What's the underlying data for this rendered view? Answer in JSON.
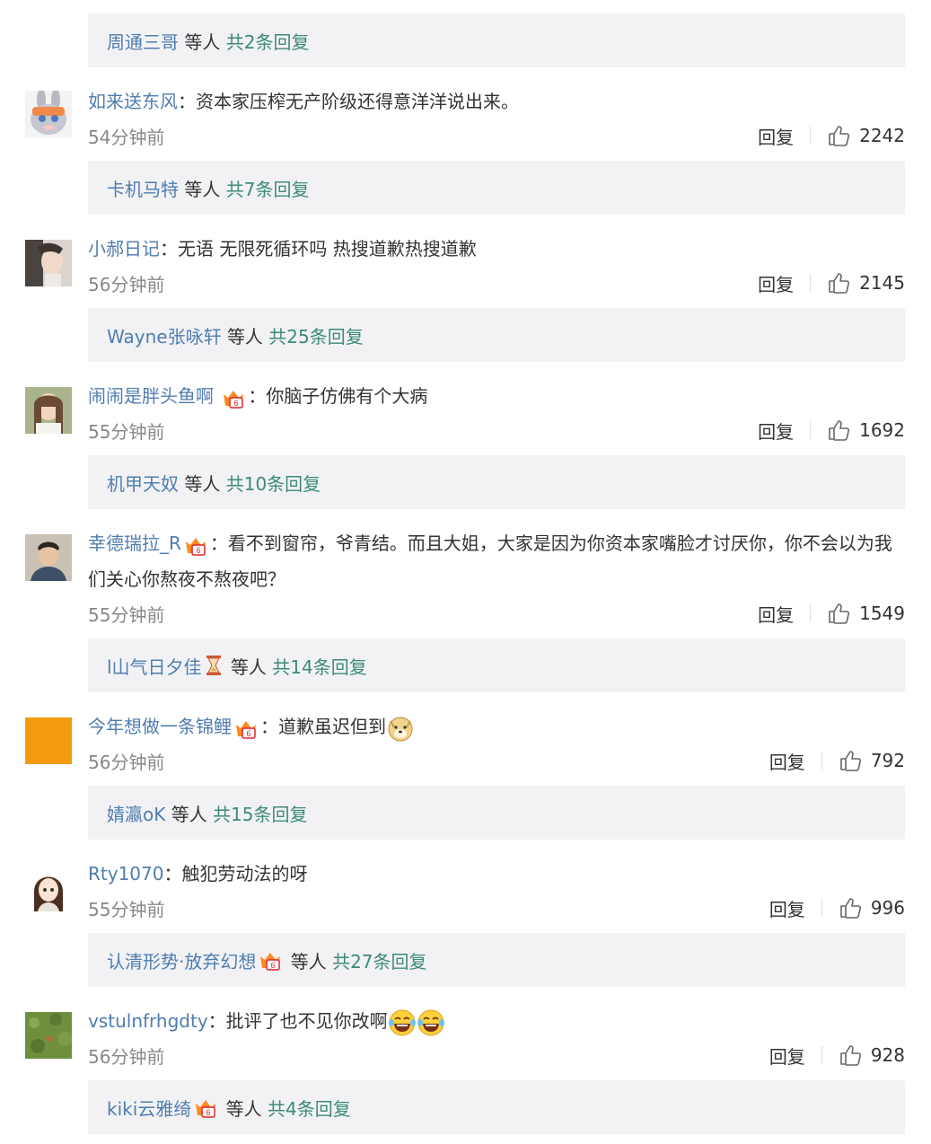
{
  "top_reply": {
    "user": "周通三哥",
    "suffix": "等人",
    "count": "共2条回复"
  },
  "reply_label": "回复",
  "comments": [
    {
      "user": "如来送东风",
      "text": "资本家压榨无产阶级还得意洋洋说出来。",
      "time": "54分钟前",
      "likes": "2242",
      "reply": {
        "user": "卡机马特",
        "suffix": "等人",
        "count": "共7条回复"
      }
    },
    {
      "user": "小郝日记",
      "text": "无语  无限死循环吗 热搜道歉热搜道歉",
      "time": "56分钟前",
      "likes": "2145",
      "reply": {
        "user": "Wayne张咏轩",
        "suffix": "等人",
        "count": "共25条回复"
      }
    },
    {
      "user": "闹闹是胖头鱼啊",
      "text": "你脑子仿佛有个大病",
      "time": "55分钟前",
      "likes": "1692",
      "reply": {
        "user": "机甲天奴",
        "suffix": "等人",
        "count": "共10条回复"
      }
    },
    {
      "user": "幸德瑞拉_R",
      "text": "看不到窗帘，爷青结。而且大姐，大家是因为你资本家嘴脸才讨厌你，你不会以为我们关心你熬夜不熬夜吧？",
      "time": "55分钟前",
      "likes": "1549",
      "reply": {
        "user": "l山气日夕佳",
        "suffix": "等人",
        "count": "共14条回复"
      }
    },
    {
      "user": "今年想做一条锦鲤",
      "text": "道歉虽迟但到",
      "time": "56分钟前",
      "likes": "792",
      "reply": {
        "user": "婧瀛oK",
        "suffix": "等人",
        "count": "共15条回复"
      }
    },
    {
      "user": "Rty1070",
      "text": "触犯劳动法的呀",
      "time": "55分钟前",
      "likes": "996",
      "reply": {
        "user": "认清形势·放弃幻想",
        "suffix": "等人",
        "count": "共27条回复"
      }
    },
    {
      "user": "vstulnfrhgdty",
      "text": "批评了也不见你改啊",
      "time": "56分钟前",
      "likes": "928",
      "reply": {
        "user": "kiki云雅绮",
        "suffix": "等人",
        "count": "共4条回复"
      }
    }
  ],
  "colors": {
    "link": "#507daf",
    "count": "#3d8a7a",
    "reply_bg": "#f2f2f5",
    "time": "#888888"
  }
}
